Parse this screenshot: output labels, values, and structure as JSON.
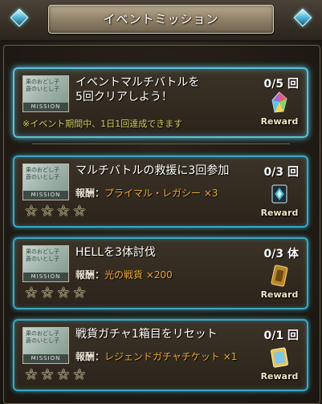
{
  "header": {
    "title": "イベントミッション"
  },
  "missions": [
    {
      "thumb_text": "果のおどし子\n蒼のいとし子",
      "thumb_band": "MISSION",
      "title_line1": "イベントマルチバトルを",
      "title_line2": "5回クリアしよう！",
      "progress": "0/5 回",
      "note": "※イベント期間中、1日1回達成できます",
      "reward_button": "Reward"
    },
    {
      "thumb_text": "果のおどし子\n蒼のいとし子",
      "thumb_band": "MISSION",
      "title": "マルチバトルの救援に3回参加",
      "progress": "0/3 回",
      "reward_key": "報酬：",
      "reward_value": "プライマル・レガシー ×3",
      "stars": [
        "☆",
        "☆",
        "☆",
        "☆"
      ],
      "reward_button": "Reward"
    },
    {
      "thumb_text": "果のおどし子\n蒼のいとし子",
      "thumb_band": "MISSION",
      "title": "HELLを3体討伐",
      "progress": "0/3 体",
      "reward_key": "報酬：",
      "reward_value": "光の戦貨 ×200",
      "stars": [
        "☆",
        "☆",
        "☆",
        "☆"
      ],
      "reward_button": "Reward"
    },
    {
      "thumb_text": "果のおどし子\n蒼のいとし子",
      "thumb_band": "MISSION",
      "title": "戦貨ガチャ1箱目をリセット",
      "progress": "0/1 回",
      "reward_key": "報酬：",
      "reward_value": "レジェンドガチャチケット ×1",
      "stars": [
        "☆",
        "☆",
        "☆",
        "☆"
      ],
      "reward_button": "Reward"
    }
  ]
}
